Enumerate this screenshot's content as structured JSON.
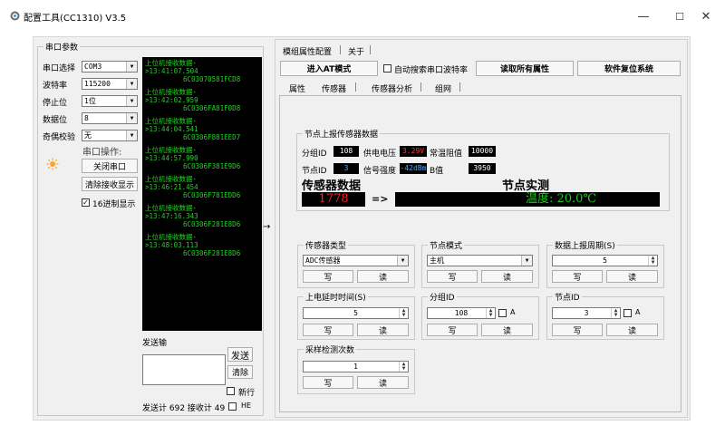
{
  "window": {
    "title": "配置工具(CC1310) V3.5",
    "minimize": "—",
    "maximize": "☐",
    "close": "✕"
  },
  "serial": {
    "group_title": "串口参数",
    "port_label": "串口选择",
    "port_value": "COM3",
    "baud_label": "波特率",
    "baud_value": "115200",
    "stop_label": "停止位",
    "stop_value": "1位",
    "data_label": "数据位",
    "data_value": "8",
    "parity_label": "奇偶校验",
    "parity_value": "无",
    "ops_label": "串口操作:",
    "close_btn": "关闭串口",
    "clear_recv_btn": "清除接收显示",
    "hex_display_label": "16进制显示",
    "hex_display_checked": "✓"
  },
  "console": {
    "entries": [
      {
        "head": "上位机接收数据-",
        "time": ">13:41:07.504",
        "data": "6C03070581FCD8"
      },
      {
        "head": "上位机接收数据-",
        "time": ">13:42:02.959",
        "data": "6C0306FA81F0D8"
      },
      {
        "head": "上位机接收数据-",
        "time": ">13:44:04.541",
        "data": "6C0306F881EED7"
      },
      {
        "head": "上位机接收数据-",
        "time": ">13:44:57.990",
        "data": "6C0306F381E9D6"
      },
      {
        "head": "上位机接收数据-",
        "time": ">13:46:21.454",
        "data": "6C0306F781EDD6"
      },
      {
        "head": "上位机接收数据-",
        "time": ">13:47:16.343",
        "data": "6C0306F281E8D6"
      },
      {
        "head": "上位机接收数据-",
        "time": ">13:48:03.113",
        "data": "6C0306F281E8D6"
      }
    ]
  },
  "send": {
    "label": "发送输",
    "send_btn": "发送",
    "clear_btn": "清除",
    "newline_label": "新行",
    "status": "发送计 692 接收计 49",
    "hex_label": "HE"
  },
  "splitter_arrow": "→",
  "right": {
    "tabs": [
      "模组属性配置",
      "关于"
    ],
    "at_mode_btn": "进入AT模式",
    "auto_baud_label": "自动搜索串口波特率",
    "read_all_btn": "读取所有属性",
    "reset_btn": "软件复位系统",
    "subtabs": [
      "属性",
      "传感器",
      "传感器分析",
      "组网"
    ],
    "report": {
      "group_title": "节点上报传感器数据",
      "group_id_label": "分组ID",
      "group_id_value": "108",
      "voltage_label": "供电电压",
      "voltage_value": "3.29V",
      "resist_label": "常温阻值",
      "resist_value": "10000",
      "node_id_label": "节点ID",
      "node_id_value": "3",
      "signal_label": "信号强度",
      "signal_value": "-42dBm",
      "b_label": "B值",
      "b_value": "3950",
      "sensor_data_title": "传感器数据",
      "realtime_title": "节点实测",
      "raw_value": "1778",
      "arrow": "=>",
      "temperature_text": "温度:  20.0℃"
    },
    "sensor_type": {
      "title": "传感器类型",
      "value": "ADC传感器",
      "write": "写",
      "read": "读"
    },
    "node_mode": {
      "title": "节点模式",
      "value": "主机",
      "write": "写",
      "read": "读"
    },
    "report_period": {
      "title": "数据上报周期(S)",
      "value": "5",
      "write": "写",
      "read": "读"
    },
    "power_delay": {
      "title": "上电延时时间(S)",
      "value": "5",
      "write": "写",
      "read": "读"
    },
    "group_id": {
      "title": "分组ID",
      "value": "108",
      "a_label": "A",
      "write": "写",
      "read": "读"
    },
    "node_id": {
      "title": "节点ID",
      "value": "3",
      "a_label": "A",
      "write": "写",
      "read": "读"
    },
    "sample_count": {
      "title": "采样检测次数",
      "value": "1",
      "write": "写",
      "read": "读"
    }
  },
  "colors": {
    "console_text": "#21d321",
    "voltage": "#ff3b3b",
    "resist": "#ffffff",
    "signal": "#4fa8ff",
    "raw_value": "#ff2020",
    "temperature": "#1ec81e"
  }
}
